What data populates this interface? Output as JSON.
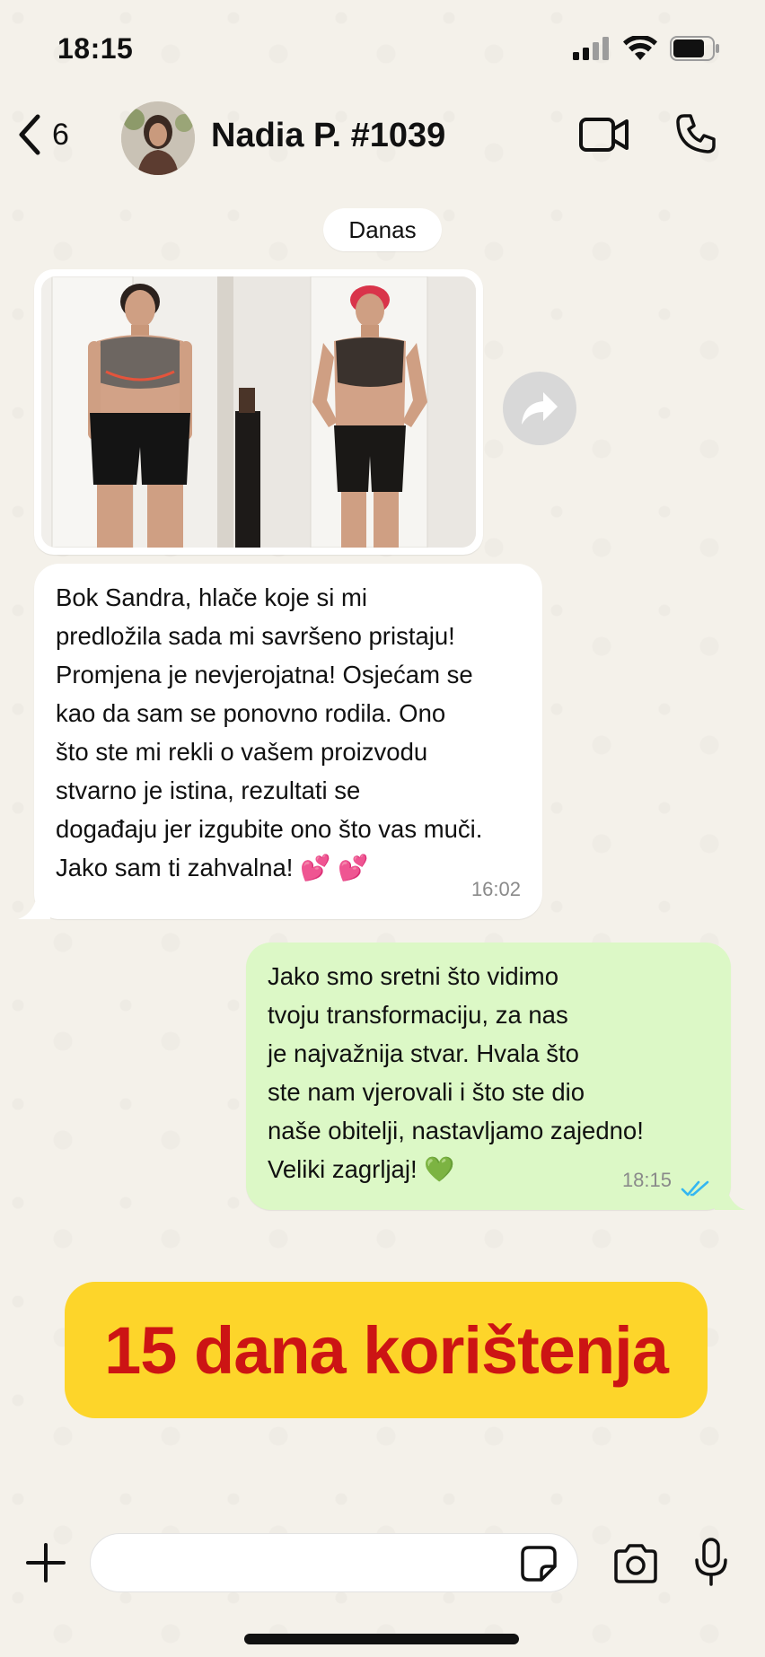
{
  "status_bar": {
    "time": "18:15",
    "icons": [
      "signal-icon",
      "wifi-icon",
      "battery-icon"
    ]
  },
  "header": {
    "back_count": "6",
    "contact_name": "Nadia P. #1039",
    "icons": [
      "chevron-left-icon",
      "video-camera-icon",
      "phone-icon"
    ]
  },
  "date_divider": "Danas",
  "messages": [
    {
      "direction": "incoming",
      "type": "image",
      "description_icons": [
        "forward-icon"
      ]
    },
    {
      "direction": "incoming",
      "type": "text",
      "lines": [
        "Bok Sandra, hlače koje si mi",
        "predložila sada mi savršeno pristaju!",
        "Promjena je nevjerojatna! Osjećam se",
        "kao da sam se ponovno rodila. Ono",
        "što ste mi rekli o vašem proizvodu",
        "stvarno je istina, rezultati se",
        "događaju jer izgubite ono što vas muči.",
        "Jako sam ti zahvalna! 💕 💕"
      ],
      "time": "16:02"
    },
    {
      "direction": "outgoing",
      "type": "text",
      "lines": [
        "Jako smo sretni što vidimo",
        "tvoju transformaciju, za nas",
        "je najvažnija stvar. Hvala što",
        "ste nam vjerovali i što ste dio",
        "naše obitelji, nastavljamo zajedno!",
        "Veliki zagrljaj! 💚"
      ],
      "time": "18:15",
      "status": "read"
    }
  ],
  "promo": {
    "text": "15 dana korištenja",
    "background": "#fdd52a",
    "color": "#cc1414"
  },
  "input_bar": {
    "placeholder": "",
    "icons": [
      "plus-icon",
      "sticker-icon",
      "camera-icon",
      "microphone-icon"
    ]
  },
  "colors": {
    "background": "#f4f1ea",
    "outgoing_bubble": "#dcf8c6",
    "incoming_bubble": "#ffffff",
    "read_ticks": "#34b7f1"
  }
}
